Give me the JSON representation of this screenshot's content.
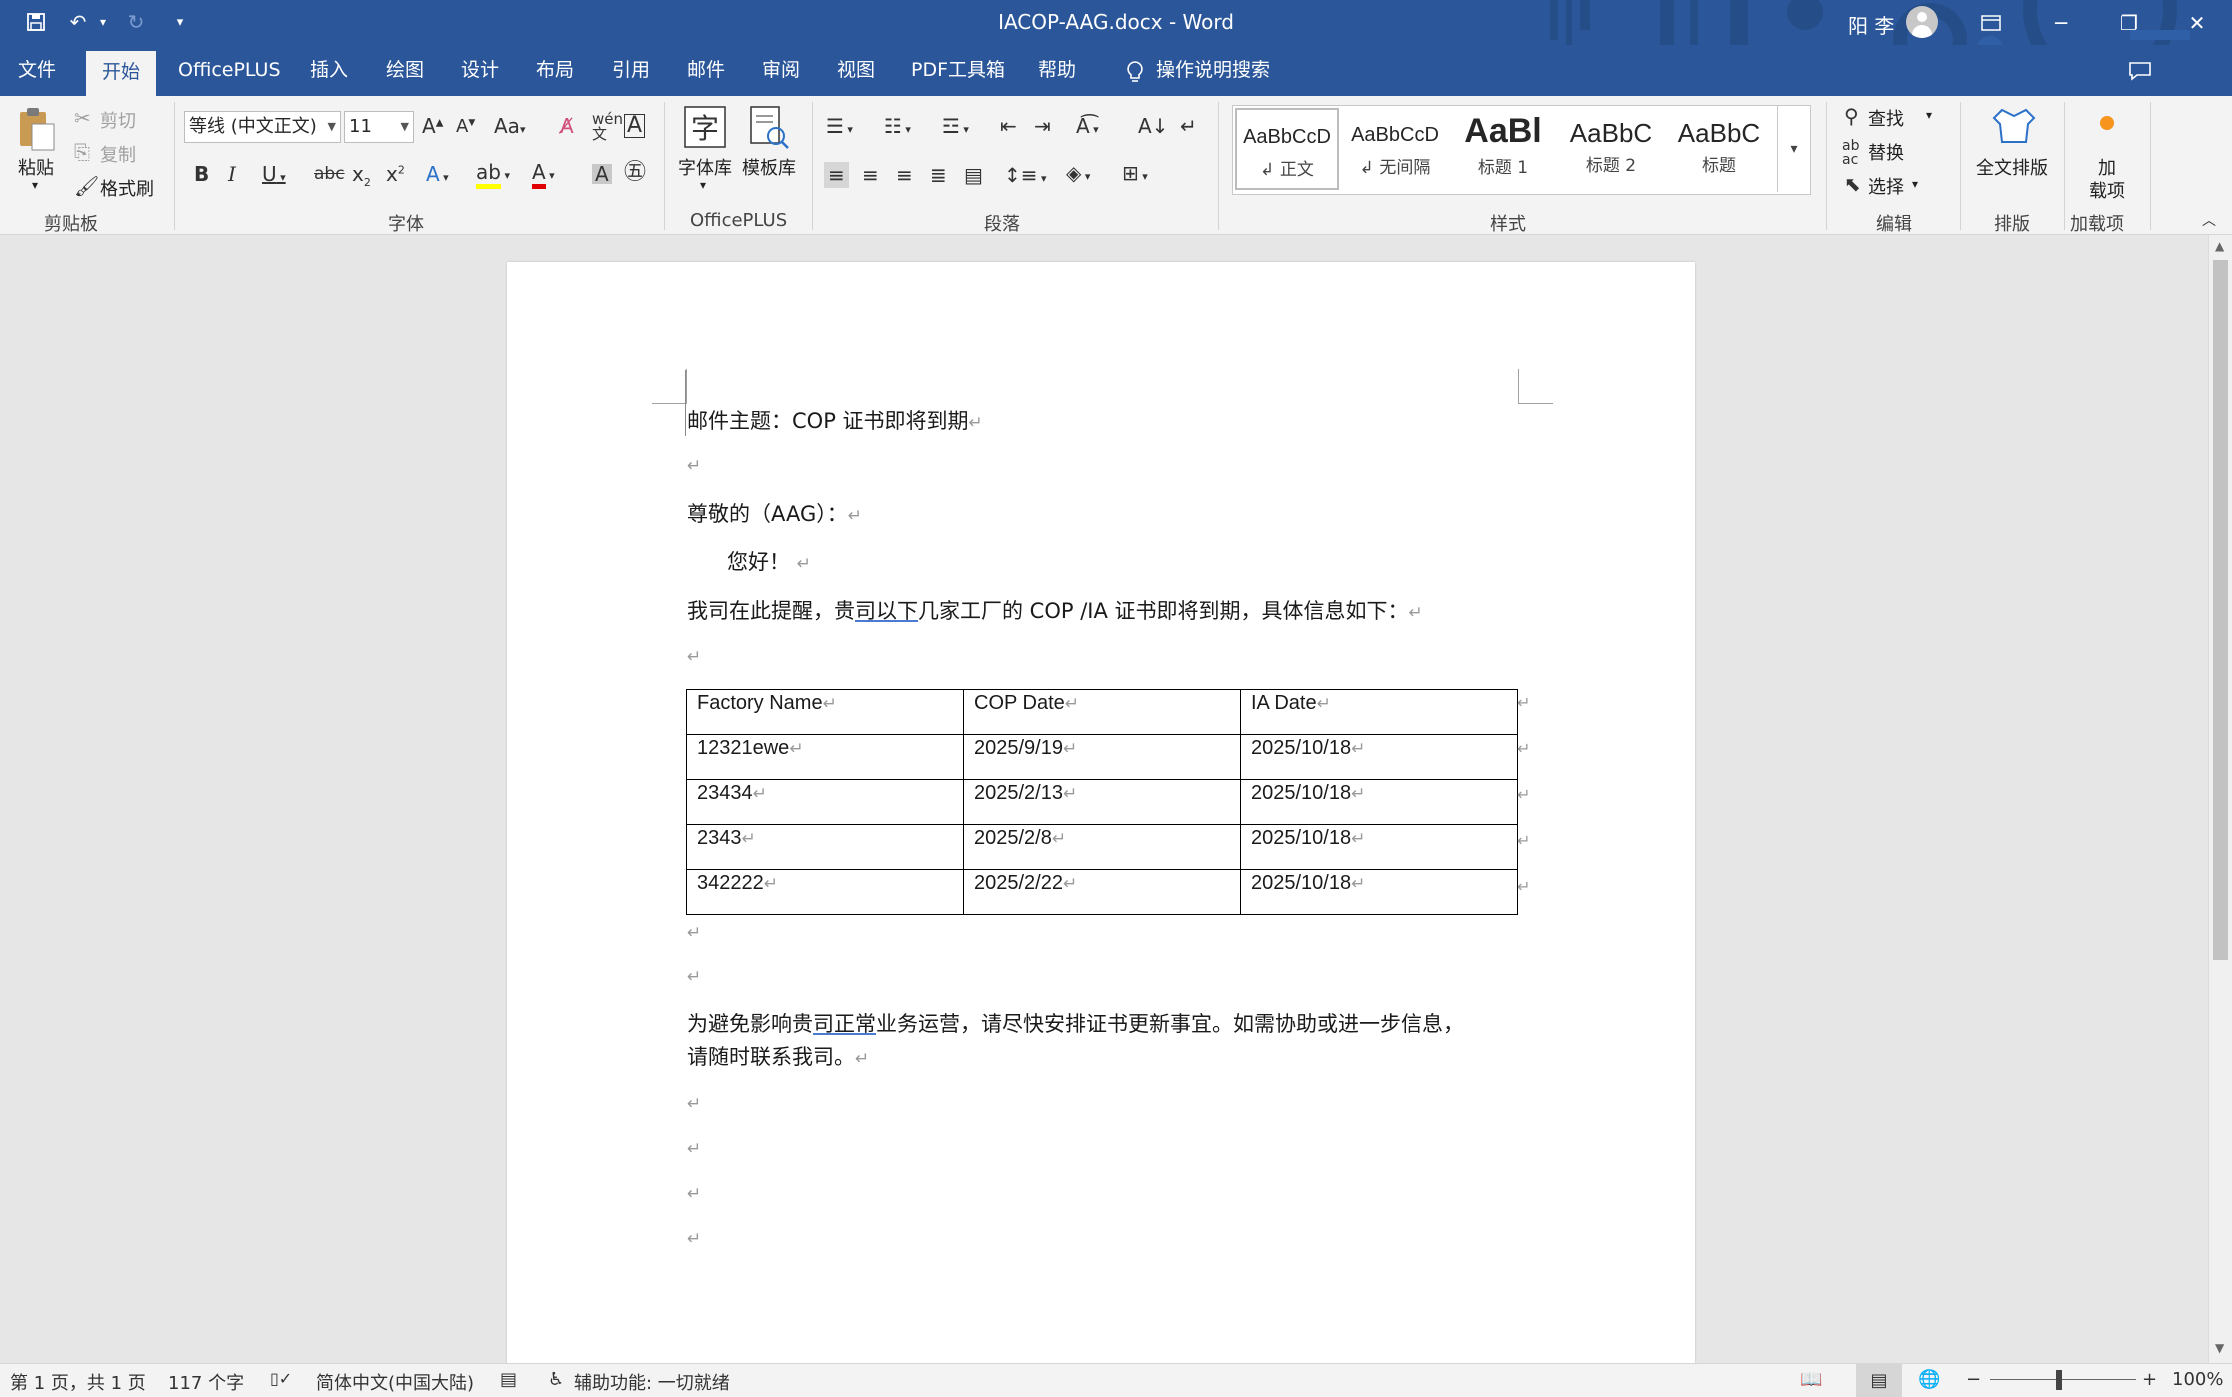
{
  "titlebar": {
    "title": "IACOP-AAG.docx  -  Word",
    "user": "阳 李",
    "qat_more": "▾"
  },
  "tabs": [
    "文件",
    "开始",
    "OfficePLUS",
    "插入",
    "绘图",
    "设计",
    "布局",
    "引用",
    "邮件",
    "审阅",
    "视图",
    "PDF工具箱",
    "帮助"
  ],
  "search_label": "操作说明搜索",
  "clipboard": {
    "paste": "粘贴",
    "cut": "剪切",
    "copy": "复制",
    "format_painter": "格式刷",
    "group": "剪贴板"
  },
  "font": {
    "name": "等线 (中文正文)",
    "size": "11",
    "group": "字体"
  },
  "officeplus": {
    "font_lib": "字体库",
    "template_lib": "模板库",
    "group": "OfficePLUS"
  },
  "paragraph": {
    "group": "段落"
  },
  "styles": {
    "group": "样式",
    "items": [
      {
        "sample": "AaBbCcD",
        "name": "↲ 正文"
      },
      {
        "sample": "AaBbCcD",
        "name": "↲ 无间隔"
      },
      {
        "sample": "AaBl",
        "name": "标题 1"
      },
      {
        "sample": "AaBbC",
        "name": "标题 2"
      },
      {
        "sample": "AaBbC",
        "name": "标题"
      }
    ]
  },
  "editing": {
    "find": "查找",
    "replace": "替换",
    "select": "选择",
    "group": "编辑"
  },
  "layout": {
    "full_layout": "全文排版",
    "group": "排版"
  },
  "addins": {
    "label1": "加",
    "label2": "载项",
    "group": "加载项"
  },
  "doc": {
    "subject": "邮件主题：COP 证书即将到期",
    "greeting": "尊敬的（AAG）：",
    "hello": "您好！",
    "intro_a": "我司在此提醒，贵",
    "intro_b": "司以下",
    "intro_c": "几家工厂的 COP /IA 证书即将到期，具体信息如下：",
    "closing1_a": "为避免影响贵",
    "closing1_b": "司正常",
    "closing1_c": "业务运营，请尽快安排证书更新事宜。如需协助或进一步信息，",
    "closing2": "请随时联系我司。",
    "mark": "↵",
    "table": {
      "headers": [
        "Factory Name",
        "COP Date",
        "IA Date"
      ],
      "rows": [
        [
          "12321ewe",
          "2025/9/19",
          "2025/10/18"
        ],
        [
          "23434",
          "2025/2/13",
          "2025/10/18"
        ],
        [
          "2343",
          "2025/2/8",
          "2025/10/18"
        ],
        [
          "342222",
          "2025/2/22",
          "2025/10/18"
        ]
      ]
    }
  },
  "status": {
    "page": "第 1 页，共 1 页",
    "words": "117 个字",
    "language": "简体中文(中国大陆)",
    "accessibility": "辅助功能: 一切就绪",
    "zoom": "100%"
  },
  "colors": {
    "brand": "#2b579a",
    "ribbon": "#f3f3f3",
    "canvas": "#e6e6e6"
  }
}
